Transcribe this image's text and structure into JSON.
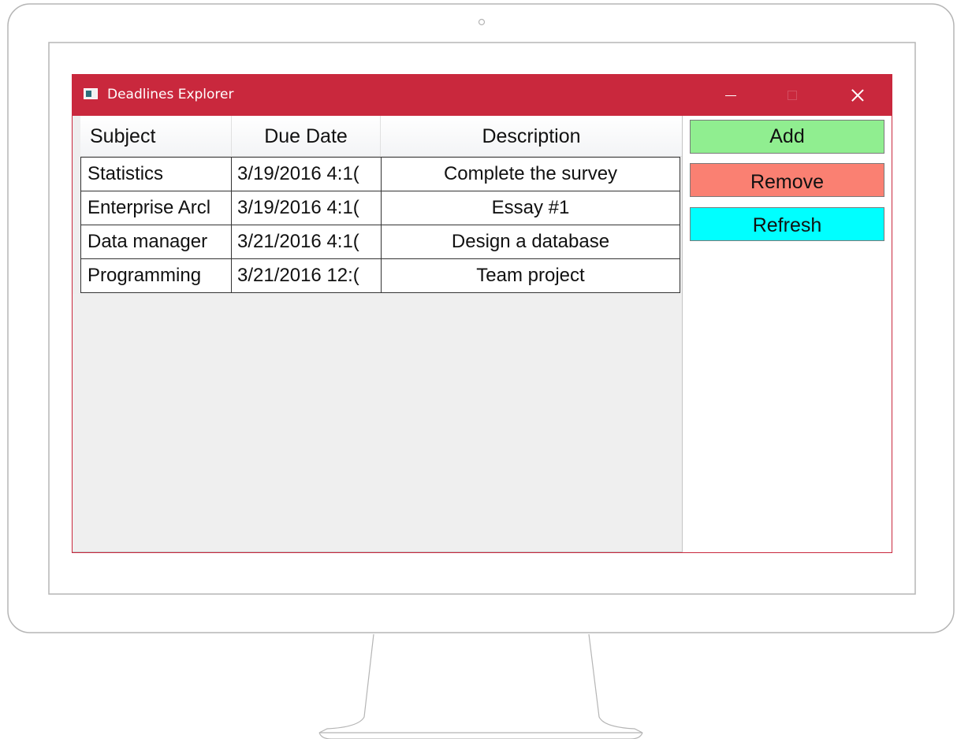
{
  "window": {
    "title": "Deadlines Explorer",
    "titlebar_color": "#c9283d",
    "icon": "app-window-icon"
  },
  "table": {
    "columns": [
      "Subject",
      "Due Date",
      "Description"
    ],
    "rows": [
      [
        "Statistics",
        "3/19/2016 4:1(",
        "Complete the survey"
      ],
      [
        "Enterprise Arcl",
        "3/19/2016 4:1(",
        "Essay #1"
      ],
      [
        "Data manager",
        "3/21/2016 4:1(",
        "Design a database"
      ],
      [
        "Programming",
        "3/21/2016 12:(",
        "Team project"
      ]
    ]
  },
  "buttons": {
    "add": {
      "label": "Add",
      "color": "#90ee90"
    },
    "remove": {
      "label": "Remove",
      "color": "#fa8072"
    },
    "refresh": {
      "label": "Refresh",
      "color": "#00ffff"
    }
  },
  "icons": {
    "minimize": "minimize-icon",
    "maximize": "maximize-icon",
    "close": "close-icon"
  }
}
